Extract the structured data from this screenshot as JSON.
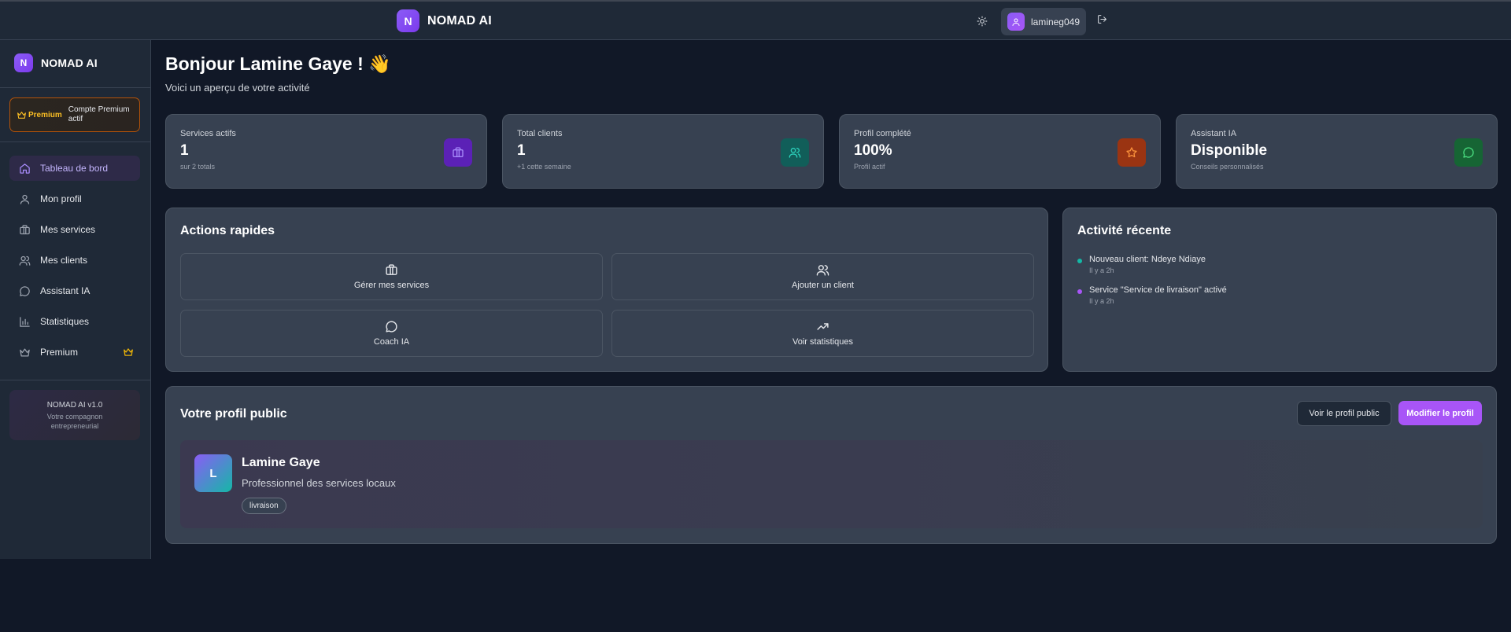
{
  "app": {
    "name": "NOMAD AI",
    "logo_letter": "N"
  },
  "topbar": {
    "username": "lamineg049"
  },
  "sidebar": {
    "premium": {
      "tag": "Premium",
      "text": "Compte Premium actif"
    },
    "items": [
      {
        "label": "Tableau de bord",
        "icon": "home-icon",
        "active": true
      },
      {
        "label": "Mon profil",
        "icon": "user-icon"
      },
      {
        "label": "Mes services",
        "icon": "briefcase-icon"
      },
      {
        "label": "Mes clients",
        "icon": "users-icon"
      },
      {
        "label": "Assistant IA",
        "icon": "message-circle-icon"
      },
      {
        "label": "Statistiques",
        "icon": "bar-chart-icon"
      },
      {
        "label": "Premium",
        "icon": "crown-icon"
      }
    ],
    "version": {
      "title": "NOMAD AI v1.0",
      "subtitle": "Votre compagnon entrepreneurial"
    }
  },
  "main": {
    "welcome": "Bonjour Lamine Gaye ! 👋",
    "subtitle": "Voici un aperçu de votre activité"
  },
  "stats": [
    {
      "label": "Services actifs",
      "value": "1",
      "sub": "sur 2 totals",
      "icon": "briefcase-icon",
      "bg": "#5b21b6",
      "color": "#a78bfa"
    },
    {
      "label": "Total clients",
      "value": "1",
      "sub": "+1 cette semaine",
      "icon": "users-icon",
      "bg": "#115e59",
      "color": "#2dd4bf"
    },
    {
      "label": "Profil complété",
      "value": "100%",
      "sub": "Profil actif",
      "icon": "star-icon",
      "bg": "#9a3412",
      "color": "#fb923c"
    },
    {
      "label": "Assistant IA",
      "value": "Disponible",
      "sub": "Conseils personnalisés",
      "icon": "message-circle-icon",
      "bg": "#166534",
      "color": "#4ade80"
    }
  ],
  "quick_actions": {
    "title": "Actions rapides",
    "items": [
      {
        "label": "Gérer mes services",
        "icon": "briefcase-icon"
      },
      {
        "label": "Ajouter un client",
        "icon": "users-icon"
      },
      {
        "label": "Coach IA",
        "icon": "message-circle-icon"
      },
      {
        "label": "Voir statistiques",
        "icon": "trending-up-icon"
      }
    ]
  },
  "activity": {
    "title": "Activité récente",
    "items": [
      {
        "title": "Nouveau client: Ndeye Ndiaye",
        "time": "Il y a 2h",
        "color": "#14b8a6"
      },
      {
        "title": "Service \"Service de livraison\" activé",
        "time": "Il y a 2h",
        "color": "#a855f7"
      }
    ]
  },
  "public_profile": {
    "title": "Votre profil public",
    "view_button": "Voir le profil public",
    "edit_button": "Modifier le profil",
    "avatar_letter": "L",
    "name": "Lamine Gaye",
    "description": "Professionnel des services locaux",
    "tag": "livraison"
  }
}
